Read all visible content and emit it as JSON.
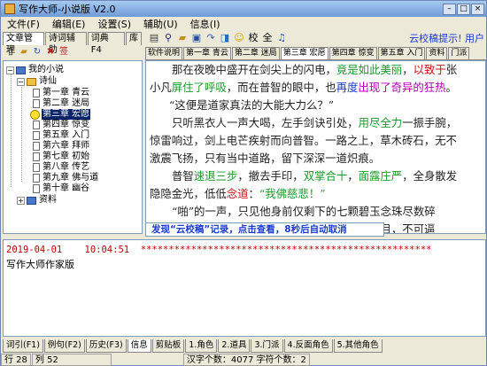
{
  "window": {
    "title": "写作大师-小说版  V2.0"
  },
  "menu": [
    "文件(F)",
    "编辑(E)",
    "设置(S)",
    "辅助(U)",
    "信息(I)"
  ],
  "left_tabs": [
    "文章管理",
    "诗词辅助",
    "词典 F4",
    "库"
  ],
  "tree": {
    "root": "我的小说",
    "book": "诗仙",
    "chapters": [
      "第一章 青云",
      "第二章 迷局",
      "第三章 宏愿",
      "第四章 惊变",
      "第五章 入门",
      "第六章 拜师",
      "第七章 初始",
      "第八章 传艺",
      "第九章 佛与道",
      "第十章 幽谷"
    ],
    "selected_index": 2,
    "data_folder": "资料"
  },
  "toolbar": {
    "icons": [
      "format-icon",
      "find-icon",
      "open-icon",
      "save-icon",
      "redo-icon",
      "bookmark-icon",
      "smile-icon",
      "proofread-icon",
      "word-icon"
    ],
    "proof_label": "校",
    "word_label": "全"
  },
  "notice": "云校稿提示! 用户",
  "chapter_tabs": [
    "软件说明",
    "第一章 青云",
    "第二章 迷局",
    "第三章 宏愿",
    "第四章 惊变",
    "第五章 入门",
    "资料",
    "门派"
  ],
  "active_chapter_tab": 3,
  "text": {
    "p1a": "那在夜晚中盛开在剑尖上的闪电，",
    "p1b": "竟是如此美丽",
    "p1c": "，",
    "p1d": "以致于",
    "p1e": "张",
    "p2a": "小凡",
    "p2b": "屏住了呼吸",
    "p2c": "，而在普智的眼中，也",
    "p2d": "再度",
    "p2e": "出现了奇异的狂热",
    "p2f": "。",
    "p3": "“这便是道家真法的大能大力么？”",
    "p4a": "只听黑衣人一声大喝，左手剑诀引处，",
    "p4b": "用尽全力",
    "p4c": "一振手腕，",
    "p5": "惊雷响过，剑上电芒疾射而向普智。一路之上，草木砖石，无不",
    "p6": "激震飞扬，只有当中道路，留下深深一道炽痕。",
    "p7a": "普智",
    "p7b": "速退三步",
    "p7c": "，撤去手印，",
    "p7d": "双掌合十",
    "p7e": "，",
    "p7f": "面露庄严",
    "p7g": "，全身散发",
    "p8a": "隐隐金光，低低",
    "p8b": "念道",
    "p8c": "：",
    "p8d": "“我佛慈悲！”",
    "p9": "“啪”的一声，只见他身前仅剩下的七颗碧玉念珠尽数碎",
    "p10": "裂，在身前三尺处幻成一个巨大“佛”字，金光耀目，不可逼",
    "p11": "视"
  },
  "popup": "发现“云校稿”记录，点击查看，8秒后自动取消",
  "log": {
    "date": "2019-04-01",
    "time": "10:04:51",
    "stars": "****************************************************",
    "line2": "写作大师作家版"
  },
  "bottom_tabs": [
    "词引(F1)",
    "例句(F2)",
    "历史(F3)",
    "信息",
    "剪贴板",
    "1.角色",
    "2.道具",
    "3.门派",
    "4.反面角色",
    "5.其他角色"
  ],
  "status": {
    "row": "行 28",
    "col": "列 52",
    "chars": "汉字个数：4077 字符个数：2"
  }
}
